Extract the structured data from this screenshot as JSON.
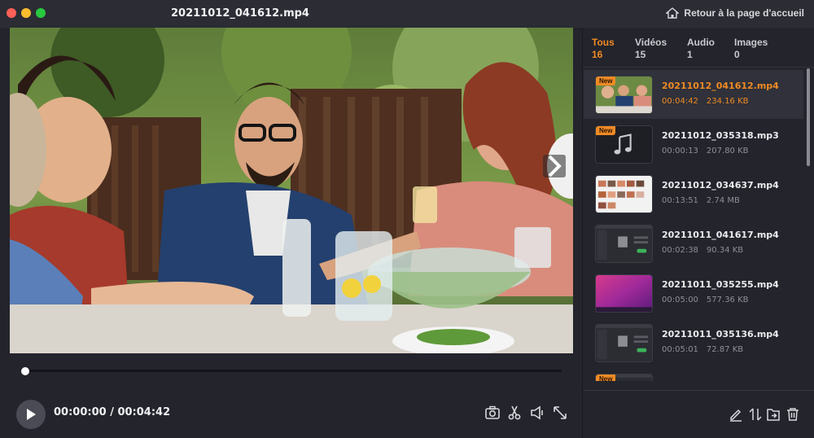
{
  "window": {
    "title": "20211012_041612.mp4",
    "home_label": "Retour à la page d'accueil",
    "home_icon": "home-icon"
  },
  "player": {
    "current_time": "00:00:00",
    "total_time": "00:04:42",
    "time_display": "00:00:00 / 00:04:42",
    "progress": 0.0,
    "play_icon": "play-icon",
    "controls": [
      "camera-icon",
      "scissors-icon",
      "speaker-icon",
      "fullscreen-icon"
    ]
  },
  "tabs": [
    {
      "label": "Tous",
      "count": "16",
      "active": true
    },
    {
      "label": "Vidéos",
      "count": "15",
      "active": false
    },
    {
      "label": "Audio",
      "count": "1",
      "active": false
    },
    {
      "label": "Images",
      "count": "0",
      "active": false
    }
  ],
  "media_items": [
    {
      "name": "20211012_041612.mp4",
      "duration": "00:04:42",
      "size": "234.16 KB",
      "new": true,
      "selected": true,
      "thumb": "video-dinner"
    },
    {
      "name": "20211012_035318.mp3",
      "duration": "00:00:13",
      "size": "207.80 KB",
      "new": true,
      "selected": false,
      "thumb": "audio-note"
    },
    {
      "name": "20211012_034637.mp4",
      "duration": "00:13:51",
      "size": "2.74 MB",
      "new": false,
      "selected": false,
      "thumb": "video-grid"
    },
    {
      "name": "20211011_041617.mp4",
      "duration": "00:02:38",
      "size": "90.34 KB",
      "new": false,
      "selected": false,
      "thumb": "video-app"
    },
    {
      "name": "20211011_035255.mp4",
      "duration": "00:05:00",
      "size": "577.36 KB",
      "new": false,
      "selected": false,
      "thumb": "video-desktop"
    },
    {
      "name": "20211011_035136.mp4",
      "duration": "00:05:01",
      "size": "72.87 KB",
      "new": false,
      "selected": false,
      "thumb": "video-app"
    },
    {
      "name": "",
      "duration": "",
      "size": "",
      "new": true,
      "selected": false,
      "thumb": "video-app"
    }
  ],
  "new_badge_label": "New",
  "toolbar": [
    "edit-icon",
    "sort-icon",
    "export-icon",
    "trash-icon"
  ],
  "colors": {
    "accent": "#f08a24",
    "background": "#23242c"
  }
}
